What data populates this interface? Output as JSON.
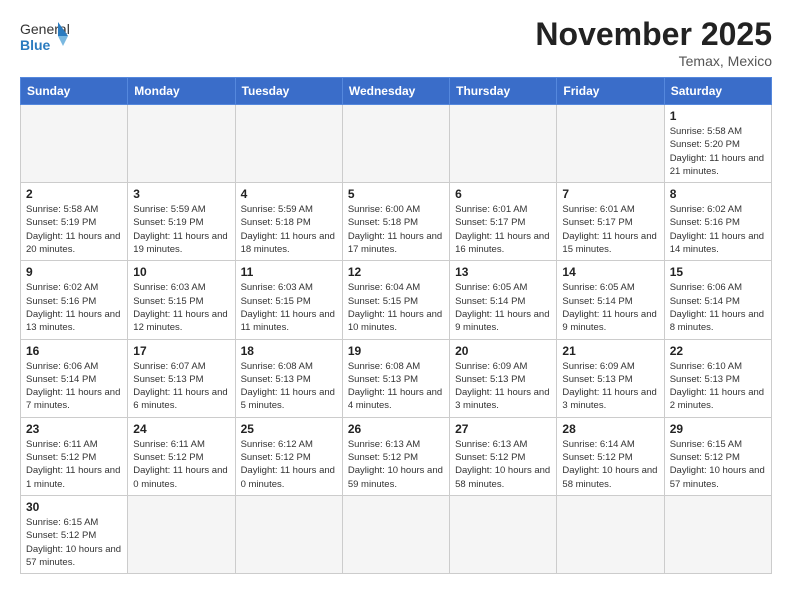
{
  "logo": {
    "general": "General",
    "blue": "Blue"
  },
  "title": "November 2025",
  "location": "Temax, Mexico",
  "days_header": [
    "Sunday",
    "Monday",
    "Tuesday",
    "Wednesday",
    "Thursday",
    "Friday",
    "Saturday"
  ],
  "weeks": [
    [
      {
        "day": "",
        "info": ""
      },
      {
        "day": "",
        "info": ""
      },
      {
        "day": "",
        "info": ""
      },
      {
        "day": "",
        "info": ""
      },
      {
        "day": "",
        "info": ""
      },
      {
        "day": "",
        "info": ""
      },
      {
        "day": "1",
        "info": "Sunrise: 5:58 AM\nSunset: 5:20 PM\nDaylight: 11 hours and 21 minutes."
      }
    ],
    [
      {
        "day": "2",
        "info": "Sunrise: 5:58 AM\nSunset: 5:19 PM\nDaylight: 11 hours and 20 minutes."
      },
      {
        "day": "3",
        "info": "Sunrise: 5:59 AM\nSunset: 5:19 PM\nDaylight: 11 hours and 19 minutes."
      },
      {
        "day": "4",
        "info": "Sunrise: 5:59 AM\nSunset: 5:18 PM\nDaylight: 11 hours and 18 minutes."
      },
      {
        "day": "5",
        "info": "Sunrise: 6:00 AM\nSunset: 5:18 PM\nDaylight: 11 hours and 17 minutes."
      },
      {
        "day": "6",
        "info": "Sunrise: 6:01 AM\nSunset: 5:17 PM\nDaylight: 11 hours and 16 minutes."
      },
      {
        "day": "7",
        "info": "Sunrise: 6:01 AM\nSunset: 5:17 PM\nDaylight: 11 hours and 15 minutes."
      },
      {
        "day": "8",
        "info": "Sunrise: 6:02 AM\nSunset: 5:16 PM\nDaylight: 11 hours and 14 minutes."
      }
    ],
    [
      {
        "day": "9",
        "info": "Sunrise: 6:02 AM\nSunset: 5:16 PM\nDaylight: 11 hours and 13 minutes."
      },
      {
        "day": "10",
        "info": "Sunrise: 6:03 AM\nSunset: 5:15 PM\nDaylight: 11 hours and 12 minutes."
      },
      {
        "day": "11",
        "info": "Sunrise: 6:03 AM\nSunset: 5:15 PM\nDaylight: 11 hours and 11 minutes."
      },
      {
        "day": "12",
        "info": "Sunrise: 6:04 AM\nSunset: 5:15 PM\nDaylight: 11 hours and 10 minutes."
      },
      {
        "day": "13",
        "info": "Sunrise: 6:05 AM\nSunset: 5:14 PM\nDaylight: 11 hours and 9 minutes."
      },
      {
        "day": "14",
        "info": "Sunrise: 6:05 AM\nSunset: 5:14 PM\nDaylight: 11 hours and 9 minutes."
      },
      {
        "day": "15",
        "info": "Sunrise: 6:06 AM\nSunset: 5:14 PM\nDaylight: 11 hours and 8 minutes."
      }
    ],
    [
      {
        "day": "16",
        "info": "Sunrise: 6:06 AM\nSunset: 5:14 PM\nDaylight: 11 hours and 7 minutes."
      },
      {
        "day": "17",
        "info": "Sunrise: 6:07 AM\nSunset: 5:13 PM\nDaylight: 11 hours and 6 minutes."
      },
      {
        "day": "18",
        "info": "Sunrise: 6:08 AM\nSunset: 5:13 PM\nDaylight: 11 hours and 5 minutes."
      },
      {
        "day": "19",
        "info": "Sunrise: 6:08 AM\nSunset: 5:13 PM\nDaylight: 11 hours and 4 minutes."
      },
      {
        "day": "20",
        "info": "Sunrise: 6:09 AM\nSunset: 5:13 PM\nDaylight: 11 hours and 3 minutes."
      },
      {
        "day": "21",
        "info": "Sunrise: 6:09 AM\nSunset: 5:13 PM\nDaylight: 11 hours and 3 minutes."
      },
      {
        "day": "22",
        "info": "Sunrise: 6:10 AM\nSunset: 5:13 PM\nDaylight: 11 hours and 2 minutes."
      }
    ],
    [
      {
        "day": "23",
        "info": "Sunrise: 6:11 AM\nSunset: 5:12 PM\nDaylight: 11 hours and 1 minute."
      },
      {
        "day": "24",
        "info": "Sunrise: 6:11 AM\nSunset: 5:12 PM\nDaylight: 11 hours and 0 minutes."
      },
      {
        "day": "25",
        "info": "Sunrise: 6:12 AM\nSunset: 5:12 PM\nDaylight: 11 hours and 0 minutes."
      },
      {
        "day": "26",
        "info": "Sunrise: 6:13 AM\nSunset: 5:12 PM\nDaylight: 10 hours and 59 minutes."
      },
      {
        "day": "27",
        "info": "Sunrise: 6:13 AM\nSunset: 5:12 PM\nDaylight: 10 hours and 58 minutes."
      },
      {
        "day": "28",
        "info": "Sunrise: 6:14 AM\nSunset: 5:12 PM\nDaylight: 10 hours and 58 minutes."
      },
      {
        "day": "29",
        "info": "Sunrise: 6:15 AM\nSunset: 5:12 PM\nDaylight: 10 hours and 57 minutes."
      }
    ],
    [
      {
        "day": "30",
        "info": "Sunrise: 6:15 AM\nSunset: 5:12 PM\nDaylight: 10 hours and 57 minutes."
      },
      {
        "day": "",
        "info": ""
      },
      {
        "day": "",
        "info": ""
      },
      {
        "day": "",
        "info": ""
      },
      {
        "day": "",
        "info": ""
      },
      {
        "day": "",
        "info": ""
      },
      {
        "day": "",
        "info": ""
      }
    ]
  ]
}
